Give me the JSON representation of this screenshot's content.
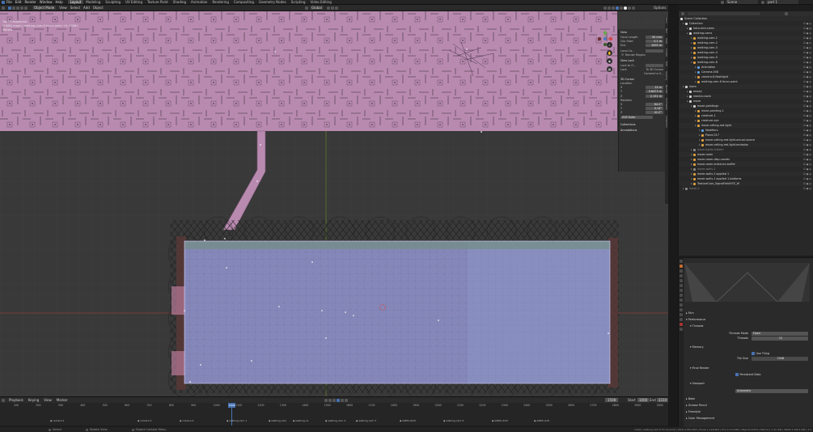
{
  "app": {
    "menus": [
      "File",
      "Edit",
      "Render",
      "Window",
      "Help"
    ],
    "workspaces": [
      "Layout",
      "Modeling",
      "Sculpting",
      "UV Editing",
      "Texture Paint",
      "Shading",
      "Animation",
      "Rendering",
      "Compositing",
      "Geometry Nodes",
      "Scripting",
      "Video Editing"
    ],
    "active_workspace": "Layout",
    "scene_label": "Scene",
    "view_layer_label": "part 1"
  },
  "viewport_header": {
    "mode": "Object Mode",
    "menus": [
      "View",
      "Select",
      "Add",
      "Object"
    ],
    "transform": "Global",
    "options": "Options"
  },
  "viewport": {
    "info_line1": "Top Orthographic",
    "info_line2": "(1508) maze | walking-cam-6 focus point +X_3308+",
    "info_line3": "Meters",
    "colors": {
      "maze_top": "#b98ab0",
      "room": "#8c8fc4",
      "background": "#393939"
    }
  },
  "npanel": {
    "view_title": "View",
    "focal_label": "Focal Length",
    "focal_value": "50 mm",
    "clip_start_label": "Clip Start",
    "clip_start_value": "0.1 m",
    "end_label": "End",
    "end_value": "1000 m",
    "local_camera_label": "Local Ca...",
    "render_region": "Render Region",
    "view_lock_title": "View Lock",
    "lock_to_object": "Lock to O...",
    "lock_label": "Lock",
    "to_3d_cursor": "To 3D Cursor",
    "camera_to_view": "Camera to V...",
    "cursor_title": "3D Cursor",
    "location_label": "Location",
    "x_label": "X",
    "x_value": "14 m",
    "y_label": "Y",
    "y_value": "0.6473 m",
    "z_label": "Z",
    "z_value": "2.151 m",
    "rotation_label": "Rotation",
    "rx_value": "84.2°",
    "ry_value": "0.14°",
    "rz_value": "41.2°",
    "rot_mode": "XYZ Euler",
    "collections": "Collections",
    "annotations": "Annotations"
  },
  "sidetabs": [
    "Item",
    "Tool",
    "View",
    "Create",
    "Edit",
    "Sapling",
    "Render",
    "Animation",
    "Collection"
  ],
  "timeline": {
    "menus": [
      "Playback",
      "Keying",
      "View",
      "Marker"
    ],
    "current_frame": "1508",
    "start_label": "Start",
    "start_value": "1000",
    "end_label": "End",
    "end_value": "3310",
    "ruler": [
      "100",
      "200",
      "300",
      "400",
      "500",
      "600",
      "700",
      "800",
      "900",
      "1000",
      "1100",
      "1200",
      "1300",
      "1400",
      "1500",
      "1600",
      "1700",
      "1800",
      "1900",
      "2000",
      "2100",
      "2200",
      "2300",
      "2400",
      "2500",
      "2600",
      "2700",
      "2800",
      "2900",
      "3000"
    ],
    "markers": [
      "camera 2",
      "camera 3",
      "camera 4",
      "walking-cam 1",
      "walking-cam",
      "walking-ca",
      "walking-cam 4",
      "walking-cam 5",
      "ANIM+RCD",
      "walking-cam 6",
      "ANIM+2CD",
      "ANIM+21S"
    ]
  },
  "outliner": {
    "title": "Scene Collection",
    "rows": [
      {
        "name": "Collection",
        "depth": 0,
        "color": "#d0d0d0"
      },
      {
        "name": "intro-end-cams",
        "depth": 1,
        "color": "#d0d0d0"
      },
      {
        "name": "walking-cams",
        "depth": 1,
        "color": "#d0d0d0"
      },
      {
        "name": "walking-cam-1",
        "depth": 2,
        "color": "#e0a040"
      },
      {
        "name": "walking-cam-2",
        "depth": 2,
        "color": "#e0a040"
      },
      {
        "name": "walking-cam-3",
        "depth": 2,
        "color": "#e0a040"
      },
      {
        "name": "walking-cam-4",
        "depth": 2,
        "color": "#e0a040"
      },
      {
        "name": "walking-cam-5",
        "depth": 2,
        "color": "#e0a040"
      },
      {
        "name": "walking-cam-6",
        "depth": 2,
        "color": "#e0a040"
      },
      {
        "name": "Animation",
        "depth": 3,
        "color": "#60a0e0"
      },
      {
        "name": "Camera.008",
        "depth": 3,
        "color": "#60a0e0"
      },
      {
        "name": "camera-6-flashlight",
        "depth": 3,
        "color": "#e0a040"
      },
      {
        "name": "walking-cam-6 focus point",
        "depth": 3,
        "color": "#e0a040"
      },
      {
        "name": "room",
        "depth": 0,
        "color": "#d0d0d0"
      },
      {
        "name": "empty",
        "depth": 1,
        "color": "#d0d0d0"
      },
      {
        "name": "reactor-room",
        "depth": 1,
        "color": "#d0d0d0"
      },
      {
        "name": "maze",
        "depth": 1,
        "color": "#d0d0d0"
      },
      {
        "name": "maze-paintings",
        "depth": 2,
        "color": "#d0d0d0"
      },
      {
        "name": "maze-painting-1",
        "depth": 3,
        "color": "#e0a040"
      },
      {
        "name": "creature-1",
        "depth": 3,
        "color": "#e0a040"
      },
      {
        "name": "creature-eye",
        "depth": 3,
        "color": "#e0a040"
      },
      {
        "name": "maze-ceiling-red-light",
        "depth": 3,
        "color": "#e0a040"
      },
      {
        "name": "Modifiers",
        "depth": 4,
        "color": "#60a0e0"
      },
      {
        "name": "Plane.017",
        "depth": 4,
        "color": "#e0a040"
      },
      {
        "name": "maze-ceiling-red-light-actual-source",
        "depth": 4,
        "color": "#e0a040"
      },
      {
        "name": "maze-ceiling-red-light-emission",
        "depth": 4,
        "color": "#e0a040"
      },
      {
        "name": "maze-lights-hidden",
        "depth": 2,
        "color": "#8a8a8a"
      },
      {
        "name": "maze-room",
        "depth": 2,
        "color": "#e0a040"
      },
      {
        "name": "maze-room-disp-coords",
        "depth": 2,
        "color": "#e0a040"
      },
      {
        "name": "maze-room-entrance-buffer",
        "depth": 2,
        "color": "#e0a040"
      },
      {
        "name": "maze-walls-1",
        "depth": 2,
        "color": "#8a8a8a"
      },
      {
        "name": "maze-walls-1 applied 1",
        "depth": 2,
        "color": "#e0a040"
      },
      {
        "name": "maze-walls-1 applied 1-bottoms",
        "depth": 2,
        "color": "#e0a040"
      },
      {
        "name": "TextureCoor_SignalFieldXYZ_W",
        "depth": 2,
        "color": "#e0a040"
      },
      {
        "name": "maze-2",
        "depth": 0,
        "color": "#8a8a8a"
      }
    ]
  },
  "properties": {
    "film": "Film",
    "performance": "Performance",
    "threads": "Threads",
    "threads_mode_label": "Threads Mode",
    "threads_mode_value": "Fixed",
    "threads_label": "Threads",
    "threads_value": "12",
    "memory": "Memory",
    "use_tiling": "Use Tiling",
    "tile_size_label": "Tile Size",
    "tile_size_value": "2048",
    "final_render": "Final Render",
    "persistent_data": "Persistent Data",
    "viewport": "Viewport",
    "pixel_size_label": "Pixel Size",
    "pixel_size_value": "Automatic",
    "bake": "Bake",
    "grease_pencil": "Grease Pencil",
    "freestyle": "Freestyle",
    "color_management": "Color Management"
  },
  "status": {
    "left1": "Select",
    "left2": "Rotate View",
    "left3": "Object Context Menu",
    "right": "maze | walking-cam-6 focus point | Verts 2,854,964 | Faces 1,124,864 | Tris 2,112,966 | Objects 0/524 | Memory 1.41 GiB | VRAM 2.3/8.0 GiB | 3.3"
  }
}
